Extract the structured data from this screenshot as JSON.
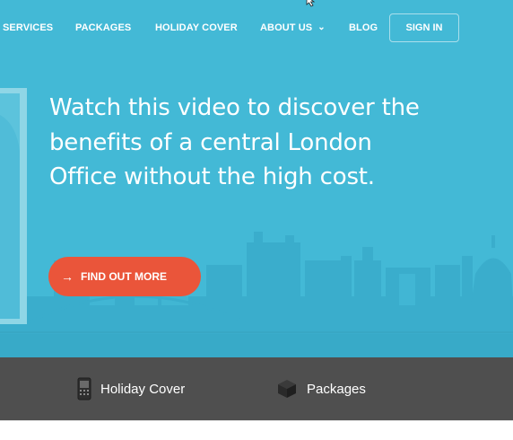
{
  "nav": {
    "items": [
      {
        "label": "SERVICES"
      },
      {
        "label": "PACKAGES"
      },
      {
        "label": "HOLIDAY COVER"
      },
      {
        "label": "ABOUT US"
      },
      {
        "label": "BLOG"
      }
    ],
    "signin_label": "SIGN IN"
  },
  "hero": {
    "headline": "Watch this video to discover the benefits of a central London Office without the high cost.",
    "cta_label": "FIND OUT MORE",
    "cta_arrow": "→"
  },
  "features": [
    {
      "label": "Holiday Cover",
      "icon": "mobile-phone-icon"
    },
    {
      "label": "Packages",
      "icon": "box-icon"
    }
  ],
  "colors": {
    "hero_bg": "#43b9d6",
    "cta_bg": "#ea553a",
    "bar_bg": "#4f4f4f"
  }
}
